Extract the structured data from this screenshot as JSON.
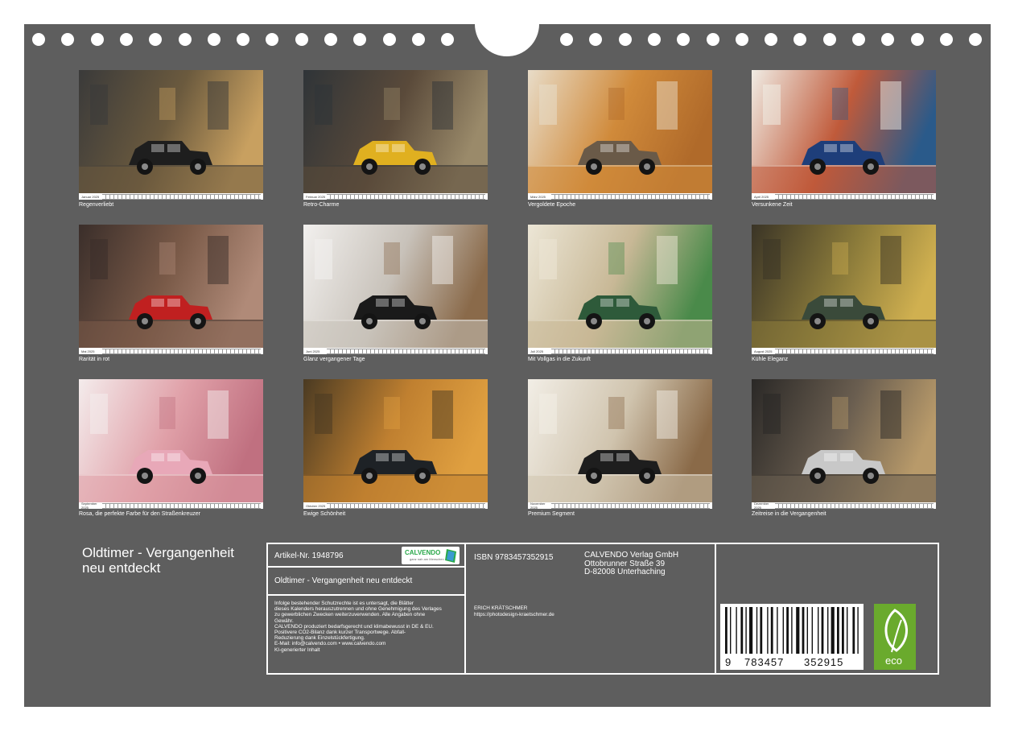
{
  "photos": [
    {
      "month": "Januar 2025",
      "caption": "Regenverliebt",
      "palette": [
        "#3a3a3a",
        "#6b5a3e",
        "#c8a060"
      ],
      "car": "#1e1e1e"
    },
    {
      "month": "Februar 2025",
      "caption": "Retro-Charme",
      "palette": [
        "#2f3438",
        "#5a4a3a",
        "#9a8a6a"
      ],
      "car": "#e0b020"
    },
    {
      "month": "März 2025",
      "caption": "Vergoldete Epoche",
      "palette": [
        "#e8dcc8",
        "#d08a3a",
        "#b06a2a"
      ],
      "car": "#6a5a48"
    },
    {
      "month": "April 2025",
      "caption": "Versunkene Zeit",
      "palette": [
        "#f0ece4",
        "#c05a3a",
        "#2a5a8a"
      ],
      "car": "#1e3e7a"
    },
    {
      "month": "Mai 2025",
      "caption": "Rarität in rot",
      "palette": [
        "#3a2e2a",
        "#7a5a48",
        "#b08a78"
      ],
      "car": "#c02020"
    },
    {
      "month": "Juni 2025",
      "caption": "Glanz vergangener Tage",
      "palette": [
        "#f2f0ee",
        "#c8c2ba",
        "#8a6a4a"
      ],
      "car": "#1a1a1a"
    },
    {
      "month": "Juli 2025",
      "caption": "Mit Vollgas in die Zukunft",
      "palette": [
        "#ece6d6",
        "#c8b896",
        "#4a8a4a"
      ],
      "car": "#2e5a3a"
    },
    {
      "month": "August 2025",
      "caption": "Kühle Eleganz",
      "palette": [
        "#3a3426",
        "#8a7a3a",
        "#d0b050"
      ],
      "car": "#3a4a3a"
    },
    {
      "month": "September 2025",
      "caption": "Rosa, die perfekte Farbe für den Straßenkreuzer",
      "palette": [
        "#f4ecec",
        "#e0a0a8",
        "#c07080"
      ],
      "car": "#e8a8b8"
    },
    {
      "month": "Oktober 2025",
      "caption": "Ewige Schönheit",
      "palette": [
        "#4a3a22",
        "#c08030",
        "#e0a040"
      ],
      "car": "#1e2226"
    },
    {
      "month": "November 2025",
      "caption": "Premium Segment",
      "palette": [
        "#f2eee6",
        "#d0c4ae",
        "#8a6a48"
      ],
      "car": "#1e1e1e"
    },
    {
      "month": "Dezember 2025",
      "caption": "Zeitreise in die Vergangenheit",
      "palette": [
        "#2a2826",
        "#6a5e50",
        "#b89a6a"
      ],
      "car": "#c8c8c8"
    }
  ],
  "colors": {
    "board": "#5e5e5e",
    "eco_green": "#6aaa2d",
    "calvendo_green": "#2aa84a"
  },
  "title": "Oldtimer - Vergangenheit neu entdeckt",
  "info": {
    "artikel": "Artikel-Nr. 1948796",
    "calvendo_logo": "CALVENDO",
    "calvendo_sub": "ganz nah am Menschen",
    "product_title": "Oldtimer - Vergangenheit neu entdeckt",
    "legal": [
      "Infolge bestehender Schutzrechte ist es untersagt, die Blätter",
      "dieses Kalenders herauszutrennen und ohne Genehmigung des Verlages",
      "zu gewerblichen Zwecken weiterzuverwenden. Alle Angaben ohne",
      "Gewähr.",
      "CALVENDO produziert bedarfsgerecht und klimabewusst in DE & EU.",
      "Positivere CO2-Bilanz dank kurzer Transportwege. Abfall-",
      "Reduzierung dank Einzelstückfertigung.",
      "E-Mail: info@calvendo.com • www.calvendo.com",
      "KI-generierter Inhalt"
    ],
    "isbn": "ISBN 9783457352915",
    "publisher": [
      "CALVENDO Verlag GmbH",
      "Ottobrunner Straße 39",
      "D-82008 Unterhaching"
    ],
    "author": "ERICH KRÄTSCHMER",
    "author_url": "https://photodesign-kraetschmer.de",
    "barcode_digits": [
      "9",
      "783457",
      "352915"
    ],
    "eco_label": "eco"
  }
}
